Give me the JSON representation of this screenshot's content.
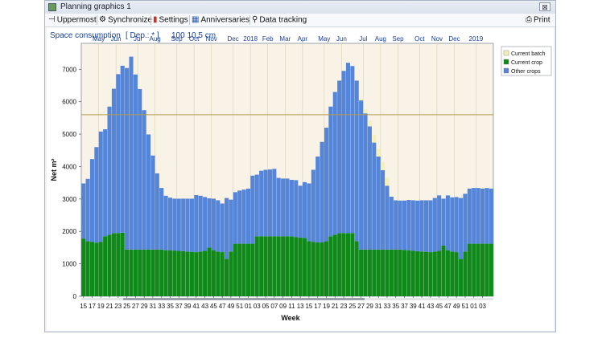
{
  "window": {
    "title": "Planning graphics 1",
    "close_label": "⊠"
  },
  "toolbar": {
    "uppermost": "Uppermost",
    "synchronize": "Synchronize",
    "settings": "Settings",
    "anniversaries": "Anniversaries",
    "data_tracking": "Data tracking",
    "print": "Print"
  },
  "header": {
    "title": "Space consumption",
    "dep": "[ Dep.: * ]",
    "value": "100 10,5 cm"
  },
  "colors": {
    "current_batch": "#f4f0b8",
    "current_crop": "#0f8a1a",
    "other_crops": "#5585d8",
    "plot_bg": "#f8f3e6",
    "ref_line": "#b09a50"
  },
  "chart_data": {
    "type": "bar",
    "stacked": true,
    "xlabel": "Week",
    "ylabel": "Net m²",
    "ylim": [
      0,
      7800
    ],
    "yticks": [
      0,
      1000,
      2000,
      3000,
      4000,
      5000,
      6000,
      7000
    ],
    "reference_line": 5600,
    "grid": "vertical-month-lines",
    "legend_position": "top-right",
    "week_labels": [
      "15",
      "17",
      "19",
      "21",
      "23",
      "25",
      "27",
      "29",
      "31",
      "33",
      "35",
      "37",
      "39",
      "41",
      "43",
      "45",
      "47",
      "49",
      "51",
      "01",
      "03",
      "05",
      "07",
      "09",
      "11",
      "13",
      "15",
      "17",
      "19",
      "21",
      "23",
      "25",
      "27",
      "29",
      "31",
      "33",
      "35",
      "37",
      "39",
      "41",
      "43",
      "45",
      "47",
      "49",
      "51",
      "01",
      "03"
    ],
    "month_labels": [
      "May",
      "Jun",
      "Jul",
      "Aug",
      "Sep",
      "Oct",
      "Nov",
      "Dec",
      "2018",
      "Feb",
      "Mar",
      "Apr",
      "May",
      "Jun",
      "Jul",
      "Aug",
      "Sep",
      "Oct",
      "Nov",
      "Dec",
      "2019"
    ],
    "month_bar_index": [
      4,
      8,
      13,
      17,
      22,
      26,
      30,
      35,
      39,
      43,
      47,
      51,
      56,
      60,
      65,
      69,
      73,
      78,
      82,
      86,
      91
    ],
    "series": [
      {
        "name": "Current batch",
        "values": [
          0,
          0,
          0,
          0,
          0,
          0,
          0,
          0,
          0,
          0,
          0,
          0,
          0,
          0,
          0,
          0,
          0,
          0,
          0,
          0,
          0,
          0,
          0,
          0,
          0,
          0,
          0,
          0,
          0,
          0,
          0,
          0,
          0,
          0,
          0,
          0,
          0,
          0,
          0,
          0,
          0,
          0,
          0,
          0,
          0,
          0,
          0,
          0,
          0,
          0,
          0,
          0,
          0,
          0,
          0,
          0,
          0,
          0,
          0,
          0,
          0,
          0,
          0,
          0,
          60,
          120,
          180,
          230,
          240,
          240,
          240,
          0,
          0,
          0,
          0,
          0,
          0,
          0,
          0,
          0,
          0,
          0,
          0,
          0,
          0,
          0,
          0,
          0,
          0,
          0,
          0,
          0,
          0,
          0,
          0
        ]
      },
      {
        "name": "Current crop",
        "values": [
          1780,
          1700,
          1680,
          1650,
          1680,
          1850,
          1900,
          1950,
          1950,
          1960,
          1440,
          1440,
          1440,
          1440,
          1440,
          1440,
          1440,
          1440,
          1440,
          1420,
          1420,
          1410,
          1400,
          1390,
          1380,
          1370,
          1360,
          1380,
          1400,
          1500,
          1420,
          1380,
          1360,
          1150,
          1380,
          1620,
          1620,
          1620,
          1620,
          1620,
          1850,
          1850,
          1850,
          1850,
          1850,
          1850,
          1850,
          1850,
          1850,
          1820,
          1810,
          1800,
          1700,
          1680,
          1660,
          1660,
          1700,
          1850,
          1900,
          1950,
          1950,
          1950,
          1950,
          1700,
          1440,
          1440,
          1440,
          1440,
          1440,
          1440,
          1440,
          1440,
          1440,
          1440,
          1430,
          1420,
          1400,
          1390,
          1380,
          1370,
          1360,
          1380,
          1400,
          1560,
          1420,
          1380,
          1360,
          1150,
          1380,
          1620,
          1620,
          1620,
          1620,
          1620,
          1620
        ]
      },
      {
        "name": "Other crops",
        "values": [
          1700,
          1920,
          2550,
          2950,
          3400,
          3300,
          3950,
          4450,
          4900,
          5150,
          5600,
          5950,
          5400,
          4950,
          4300,
          3550,
          2900,
          2350,
          1900,
          1680,
          1620,
          1600,
          1610,
          1620,
          1630,
          1640,
          1760,
          1720,
          1660,
          1520,
          1590,
          1580,
          1500,
          1880,
          1600,
          1590,
          1640,
          1670,
          1700,
          2100,
          1900,
          2020,
          2050,
          2060,
          2080,
          1800,
          1780,
          1780,
          1740,
          1760,
          1600,
          1720,
          1780,
          2220,
          2650,
          3100,
          3500,
          4000,
          4400,
          4700,
          5000,
          5250,
          5150,
          4950,
          4600,
          4200,
          3800,
          3300,
          2870,
          2450,
          1970,
          1630,
          1520,
          1510,
          1520,
          1550,
          1560,
          1560,
          1580,
          1590,
          1600,
          1650,
          1710,
          1450,
          1690,
          1670,
          1700,
          1880,
          1780,
          1700,
          1720,
          1720,
          1700,
          1720,
          1700
        ]
      }
    ]
  }
}
